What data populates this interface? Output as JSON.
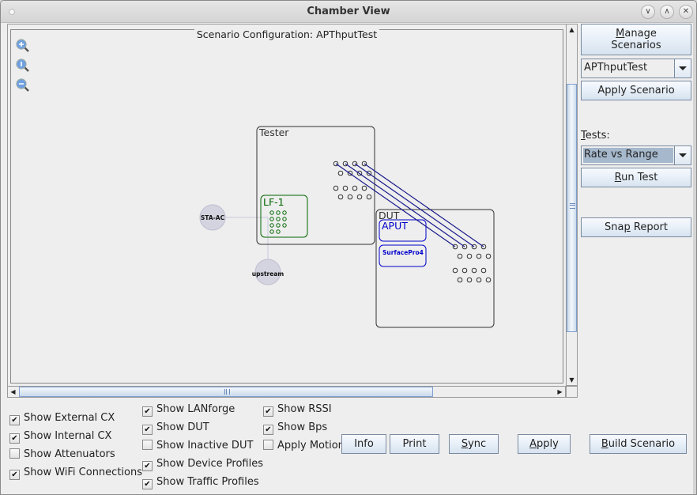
{
  "window": {
    "title": "Chamber View",
    "controls": [
      "minimize",
      "maximize",
      "close"
    ]
  },
  "canvas": {
    "panel_title": "Scenario Configuration:  APThputTest",
    "zoom_controls": [
      {
        "name": "zoom-in-icon",
        "glyph": "+"
      },
      {
        "name": "zoom-reset-icon",
        "glyph": "1"
      },
      {
        "name": "zoom-out-icon",
        "glyph": "−"
      }
    ],
    "nodes": {
      "tester": {
        "label": "Tester"
      },
      "lf1": {
        "label": "LF-1",
        "color": "#006600"
      },
      "sta_ac": {
        "label": "STA-AC"
      },
      "upstream": {
        "label": "upstream"
      },
      "dut": {
        "label": "DUT"
      },
      "aput": {
        "label": "APUT",
        "color": "#0000cc"
      },
      "surfacepro4": {
        "label": "SurfacePro4",
        "color": "#0000cc"
      }
    },
    "connection_color": "#1a1a8c"
  },
  "sidebar": {
    "manage_scenarios": {
      "line1": "Manage",
      "line1_mnemonic": "M",
      "line1_rest": "anage",
      "line2": "Scenarios"
    },
    "scenario_select": {
      "value": "APThputTest"
    },
    "apply_scenario": "Apply Scenario",
    "tests_label": {
      "mnemonic": "T",
      "rest": "ests:"
    },
    "test_select": {
      "value": "Rate vs Range"
    },
    "run_test": {
      "mnemonic": "R",
      "rest": "un Test"
    },
    "snap_report": {
      "pre": "Sna",
      "mnemonic": "p",
      "rest": " Report"
    }
  },
  "options": {
    "col1": [
      {
        "label": "Show External CX",
        "checked": true
      },
      {
        "label": "Show Internal CX",
        "checked": true
      },
      {
        "label": "Show Attenuators",
        "checked": false
      },
      {
        "label": "Show WiFi Connections",
        "checked": true
      }
    ],
    "col2": [
      {
        "label": "Show LANforge",
        "checked": true
      },
      {
        "label": "Show DUT",
        "checked": true
      },
      {
        "label": "Show Inactive DUT",
        "checked": false
      },
      {
        "label": "Show Device Profiles",
        "checked": true
      },
      {
        "label": "Show Traffic Profiles",
        "checked": true
      }
    ],
    "col3": [
      {
        "label": "Show RSSI",
        "checked": true
      },
      {
        "label": "Show Bps",
        "checked": true
      },
      {
        "label": "Apply Motion",
        "checked": false
      }
    ]
  },
  "actions": {
    "info": "Info",
    "print": "Print",
    "sync": {
      "mnemonic": "S",
      "rest": "ync"
    },
    "apply": {
      "mnemonic": "A",
      "rest": "pply"
    },
    "build": {
      "mnemonic": "B",
      "rest": "uild Scenario"
    }
  }
}
